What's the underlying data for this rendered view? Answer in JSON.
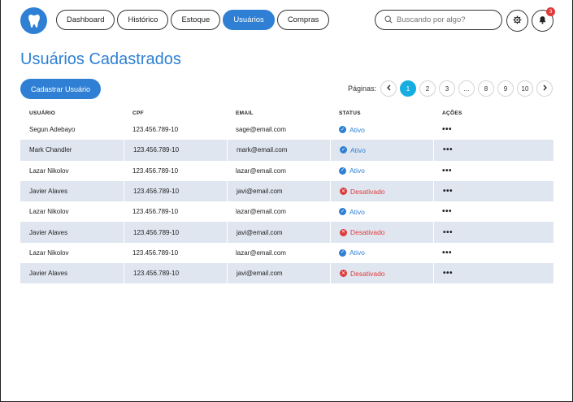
{
  "header": {
    "logo_icon": "tooth-icon",
    "nav": [
      {
        "label": "Dashboard",
        "active": false
      },
      {
        "label": "Histórico",
        "active": false
      },
      {
        "label": "Estoque",
        "active": false
      },
      {
        "label": "Usuários",
        "active": true
      },
      {
        "label": "Compras",
        "active": false
      }
    ],
    "search_placeholder": "Buscando por algo?",
    "notification_count": "3"
  },
  "page": {
    "title": "Usuários Cadastrados",
    "add_button": "Cadastrar Usuário"
  },
  "pagination": {
    "label": "Páginas:",
    "pages": [
      "1",
      "2",
      "3",
      "...",
      "8",
      "9",
      "10"
    ],
    "current": "1"
  },
  "table": {
    "columns": [
      "USUÁRIO",
      "CPF",
      "EMAIL",
      "STATUS",
      "AÇÕES"
    ],
    "rows": [
      {
        "user": "Segun Adebayo",
        "cpf": "123.456.789-10",
        "email": "sage@email.com",
        "status": "Ativo",
        "active": true,
        "actions": "•••"
      },
      {
        "user": "Mark Chandler",
        "cpf": "123.456.789-10",
        "email": "mark@email.com",
        "status": "Ativo",
        "active": true,
        "actions": "•••"
      },
      {
        "user": "Lazar Nikolov",
        "cpf": "123.456.789-10",
        "email": "lazar@email.com",
        "status": "Ativo",
        "active": true,
        "actions": "•••"
      },
      {
        "user": "Javier Alaves",
        "cpf": "123.456.789-10",
        "email": "javi@email.com",
        "status": "Desativado",
        "active": false,
        "actions": "•••"
      },
      {
        "user": "Lazar Nikolov",
        "cpf": "123.456.789-10",
        "email": "lazar@email.com",
        "status": "Ativo",
        "active": true,
        "actions": "•••"
      },
      {
        "user": "Javier Alaves",
        "cpf": "123.456.789-10",
        "email": "javi@email.com",
        "status": "Desativado",
        "active": false,
        "actions": "•••"
      },
      {
        "user": "Lazar Nikolov",
        "cpf": "123.456.789-10",
        "email": "lazar@email.com",
        "status": "Ativo",
        "active": true,
        "actions": "•••"
      },
      {
        "user": "Javier Alaves",
        "cpf": "123.456.789-10",
        "email": "javi@email.com",
        "status": "Desativado",
        "active": false,
        "actions": "•••"
      }
    ]
  },
  "colors": {
    "primary": "#2f80d4",
    "pagination_active": "#16aee0",
    "danger": "#e03a3a",
    "row_alt": "#dfe6f0"
  }
}
